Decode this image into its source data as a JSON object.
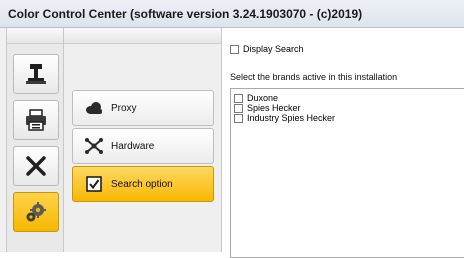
{
  "window": {
    "title": "Color Control Center (software version 3.24.1903070 - (c)2019)"
  },
  "left_tools": [
    {
      "name": "scale-tool",
      "icon": "scale-icon",
      "active": false
    },
    {
      "name": "printer-tool",
      "icon": "printer-icon",
      "active": false
    },
    {
      "name": "tools-tool",
      "icon": "wrench-screwdriver-icon",
      "active": false
    },
    {
      "name": "settings-tool",
      "icon": "gears-icon",
      "active": true
    }
  ],
  "nav": {
    "proxy": {
      "label": "Proxy",
      "icon": "cloud-icon"
    },
    "hardware": {
      "label": "Hardware",
      "icon": "network-icon"
    },
    "search_option": {
      "label": "Search option",
      "icon": "checkbox-checked-icon",
      "active": true
    }
  },
  "content": {
    "display_search": {
      "label": "Display Search",
      "checked": false
    },
    "brands_label": "Select the brands active in this installation",
    "brands": [
      {
        "label": "Duxone",
        "checked": false
      },
      {
        "label": "Spies Hecker",
        "checked": false
      },
      {
        "label": "Industry Spies Hecker",
        "checked": false
      }
    ]
  },
  "colors": {
    "active_accent": "#f5b800",
    "title_bar": "#dde3ec"
  }
}
